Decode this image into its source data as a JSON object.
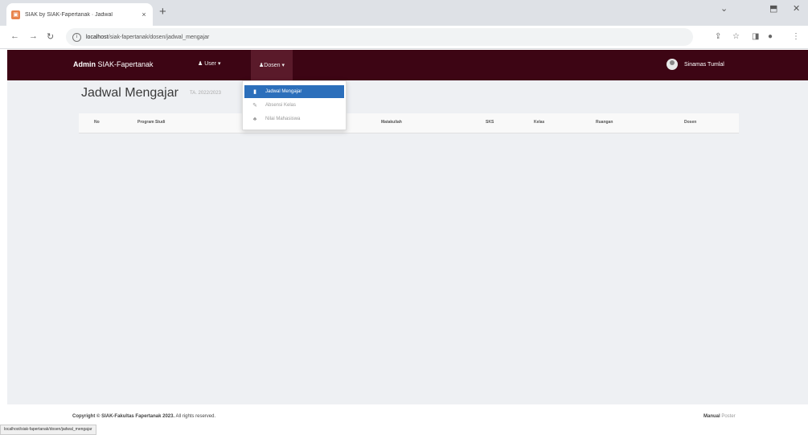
{
  "browser": {
    "tab_title": "SIAK by SIAK-Fapertanak · Jadwal",
    "tab_close": "×",
    "new_tab": "+",
    "url_host": "localhost",
    "url_path": "/siak-fapertanak/dosen/jadwal_mengajar",
    "window_minimize": "⌄",
    "window_restore": "⬒",
    "window_close": "✕"
  },
  "navbar": {
    "brand_bold": "Admin",
    "brand_rest": " SIAK-Fapertanak",
    "user_menu": "User ▾",
    "dosen_menu": "Dosen ▾",
    "user_name": "Sinamas Tumlal"
  },
  "page": {
    "title": "Jadwal Mengajar",
    "subtitle": "TA. 2022/2023"
  },
  "table": {
    "headers": [
      "No",
      "Program Studi",
      "",
      "Matakuliah",
      "SKS",
      "Kelas",
      "Ruangan",
      "Dosen"
    ]
  },
  "dropdown": {
    "items": [
      {
        "label": "Jadwal Mengajar",
        "icon": "book-icon"
      },
      {
        "label": "Absensi Kelas",
        "icon": "pen-icon"
      },
      {
        "label": "Nilai Mahasiswa",
        "icon": "users-icon"
      }
    ]
  },
  "footer": {
    "copyright_bold": "Copyright © SIAK-Fakultas Fapertanak 2023.",
    "copyright_rest": " All rights reserved.",
    "manual_bold": "Manual",
    "manual_rest": " Poster"
  },
  "status_bar": "localhost/siak-fapertanak/dosen/jadwal_mengajar",
  "colors": {
    "navbar": "#3d0514",
    "dropdown_active": "#2c6fbb",
    "favicon": "#e8834c"
  }
}
